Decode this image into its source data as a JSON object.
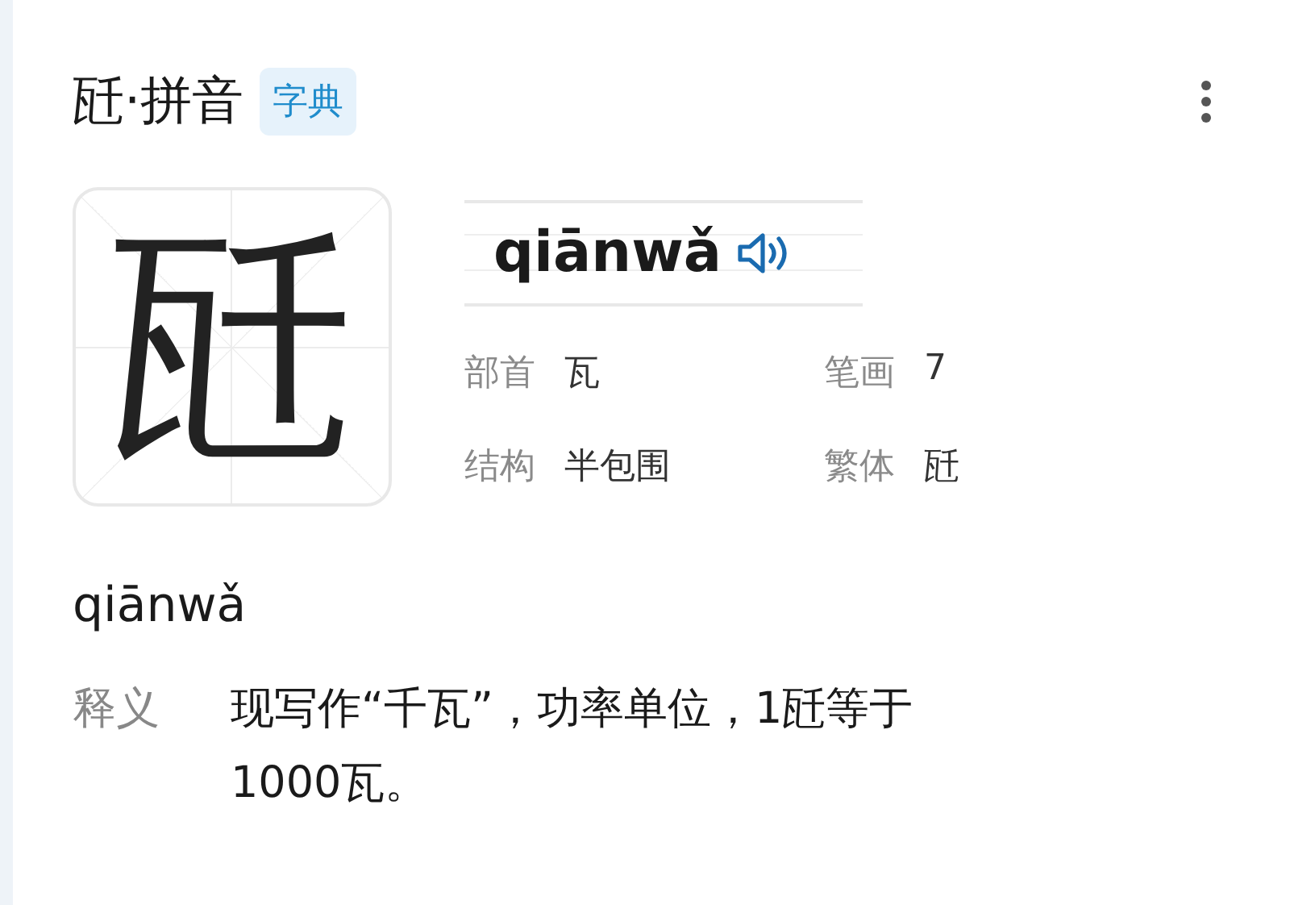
{
  "header": {
    "title": "瓩·拼音",
    "badge": "字典"
  },
  "character": {
    "glyph": "瓩",
    "pinyin": "qiānwǎ"
  },
  "info": [
    {
      "label": "部首",
      "value": "瓦"
    },
    {
      "label": "笔画",
      "value": "7"
    },
    {
      "label": "结构",
      "value": "半包围"
    },
    {
      "label": "繁体",
      "value": "瓩"
    }
  ],
  "readings": [
    {
      "pinyin": "qiānwǎ",
      "definitions": [
        {
          "label": "释义",
          "text": "现写作“千瓦”，功率单位，1瓩等于1000瓦。"
        }
      ]
    }
  ]
}
